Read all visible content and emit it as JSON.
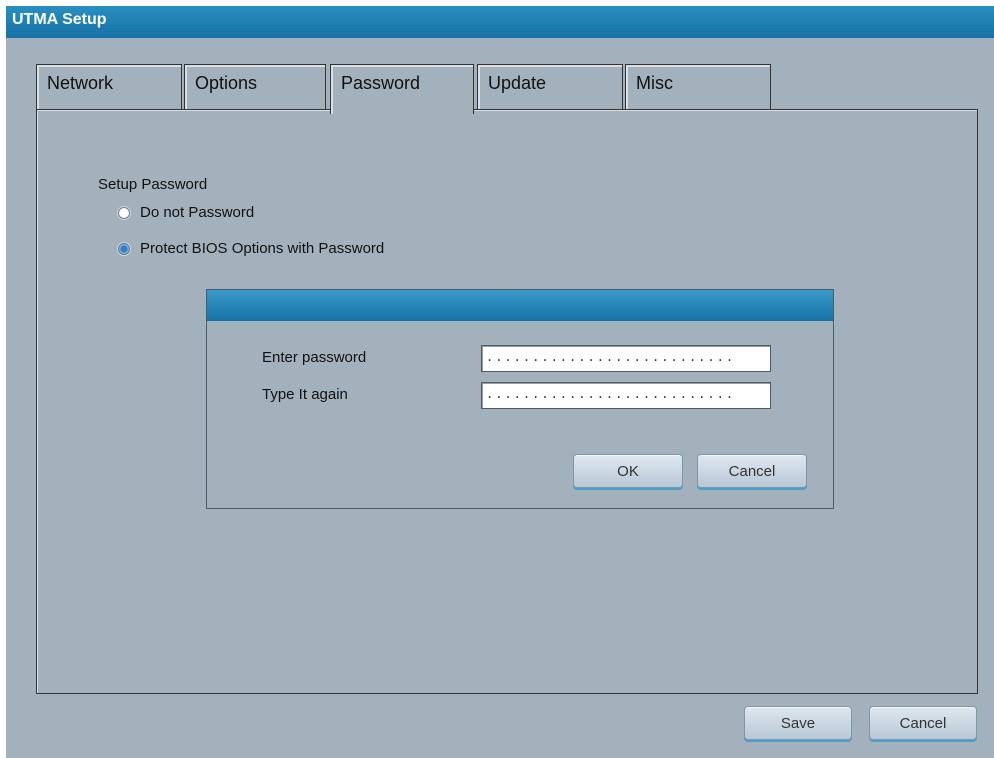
{
  "window": {
    "title": "UTMA Setup"
  },
  "tabs": [
    {
      "label": "Network"
    },
    {
      "label": "Options"
    },
    {
      "label": "Password",
      "active": true
    },
    {
      "label": "Update"
    },
    {
      "label": "Misc"
    }
  ],
  "password_panel": {
    "section_label": "Setup Password",
    "options": [
      {
        "label": "Do not Password",
        "checked": false
      },
      {
        "label": "Protect BIOS Options with Password",
        "checked": true
      }
    ],
    "dialog": {
      "enter_label": "Enter password",
      "again_label": "Type It again",
      "enter_value": "...........................",
      "again_value": "...........................",
      "ok_label": "OK",
      "cancel_label": "Cancel"
    }
  },
  "footer": {
    "save_label": "Save",
    "cancel_label": "Cancel"
  },
  "colors": {
    "background": "#a3b1bd",
    "titlebar": "#1672a6",
    "accent_shadow": "#4aa0c8"
  }
}
